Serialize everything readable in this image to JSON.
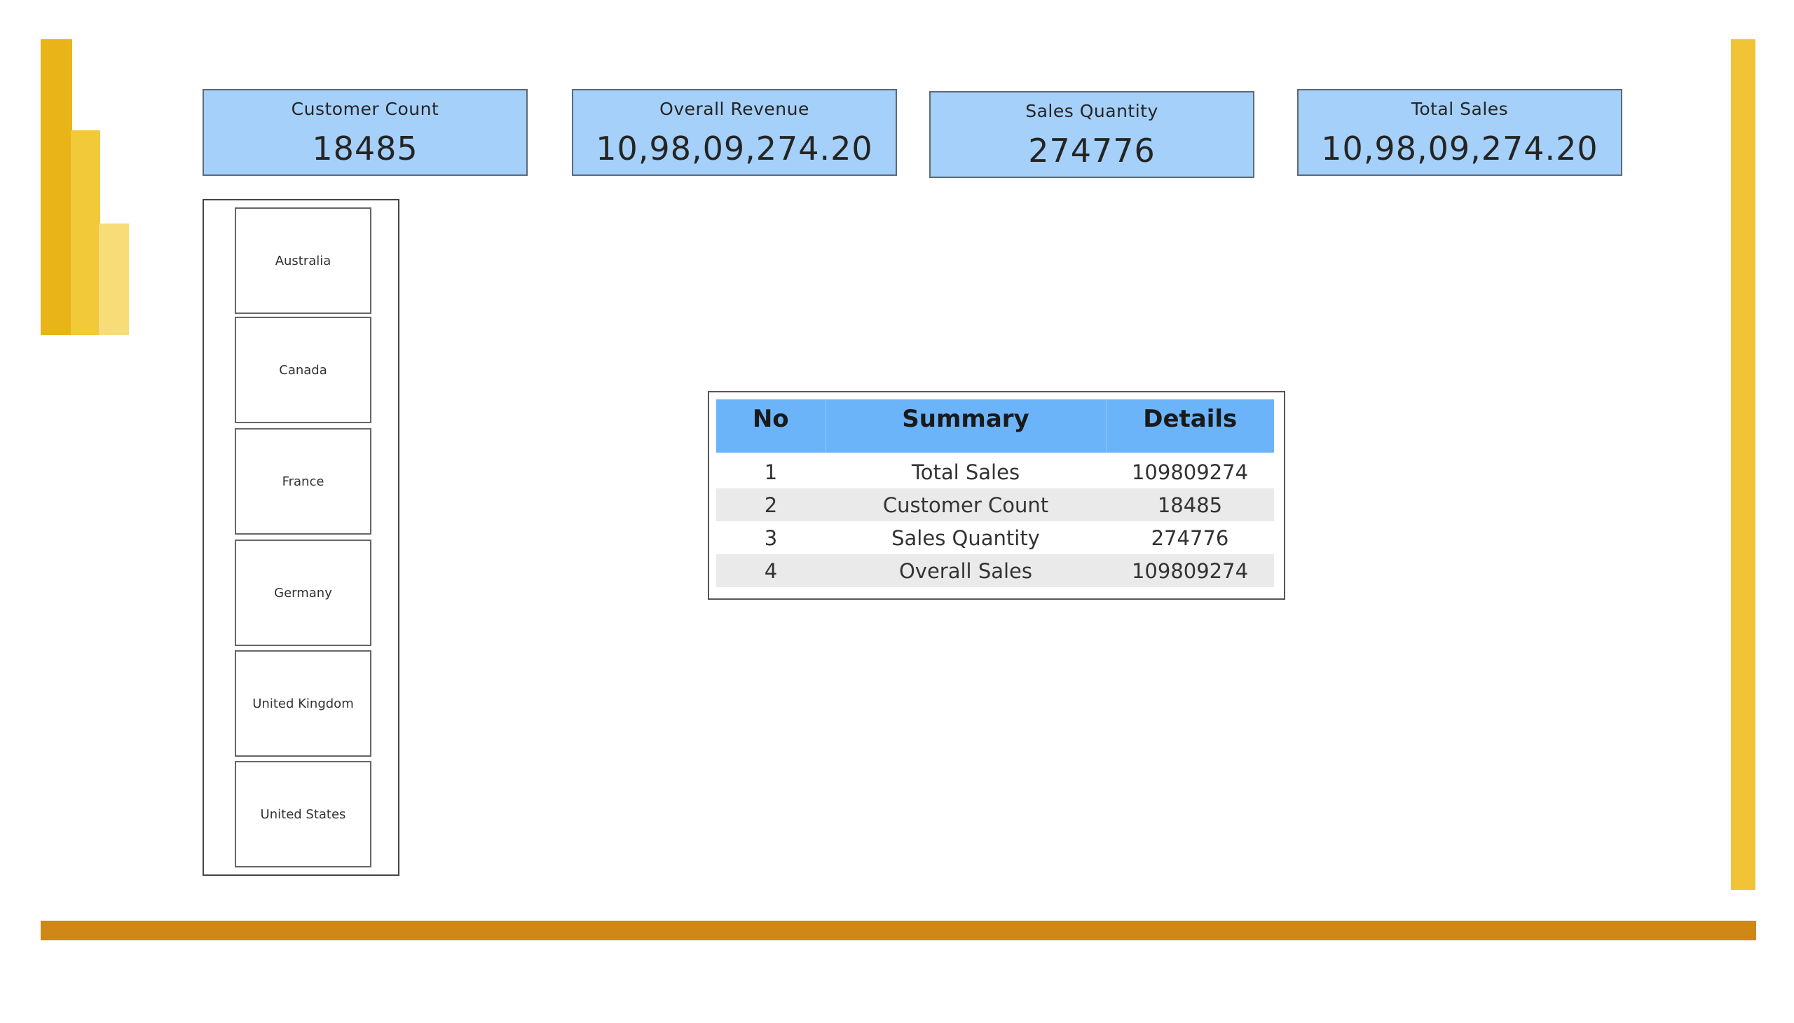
{
  "colors": {
    "logo_bar_dark": "#E8B417",
    "logo_bar_mid": "#F2C939",
    "logo_bar_light": "#F7DC77",
    "right_accent": "#F0C436",
    "bottom_accent": "#CF8716",
    "card_background": "#A4D0FA",
    "table_header": "#6CB4FA",
    "table_row_shade": "#EAEAEA"
  },
  "kpis": {
    "customer_count": {
      "label": "Customer Count",
      "value": "18485"
    },
    "overall_revenue": {
      "label": "Overall Revenue",
      "value": "10,98,09,274.20"
    },
    "sales_quantity": {
      "label": "Sales Quantity",
      "value": "274776"
    },
    "total_sales": {
      "label": "Total Sales",
      "value": "10,98,09,274.20"
    }
  },
  "slicer": {
    "items": [
      {
        "label": "Australia"
      },
      {
        "label": "Canada"
      },
      {
        "label": "France"
      },
      {
        "label": "Germany"
      },
      {
        "label": "United Kingdom"
      },
      {
        "label": "United States"
      }
    ]
  },
  "summary_table": {
    "headers": {
      "no": "No",
      "summary": "Summary",
      "details": "Details"
    },
    "rows": [
      {
        "no": "1",
        "summary": "Total Sales",
        "details": "109809274"
      },
      {
        "no": "2",
        "summary": "Customer Count",
        "details": "18485"
      },
      {
        "no": "3",
        "summary": "Sales Quantity",
        "details": "274776"
      },
      {
        "no": "4",
        "summary": "Overall Sales",
        "details": "109809274"
      }
    ]
  }
}
